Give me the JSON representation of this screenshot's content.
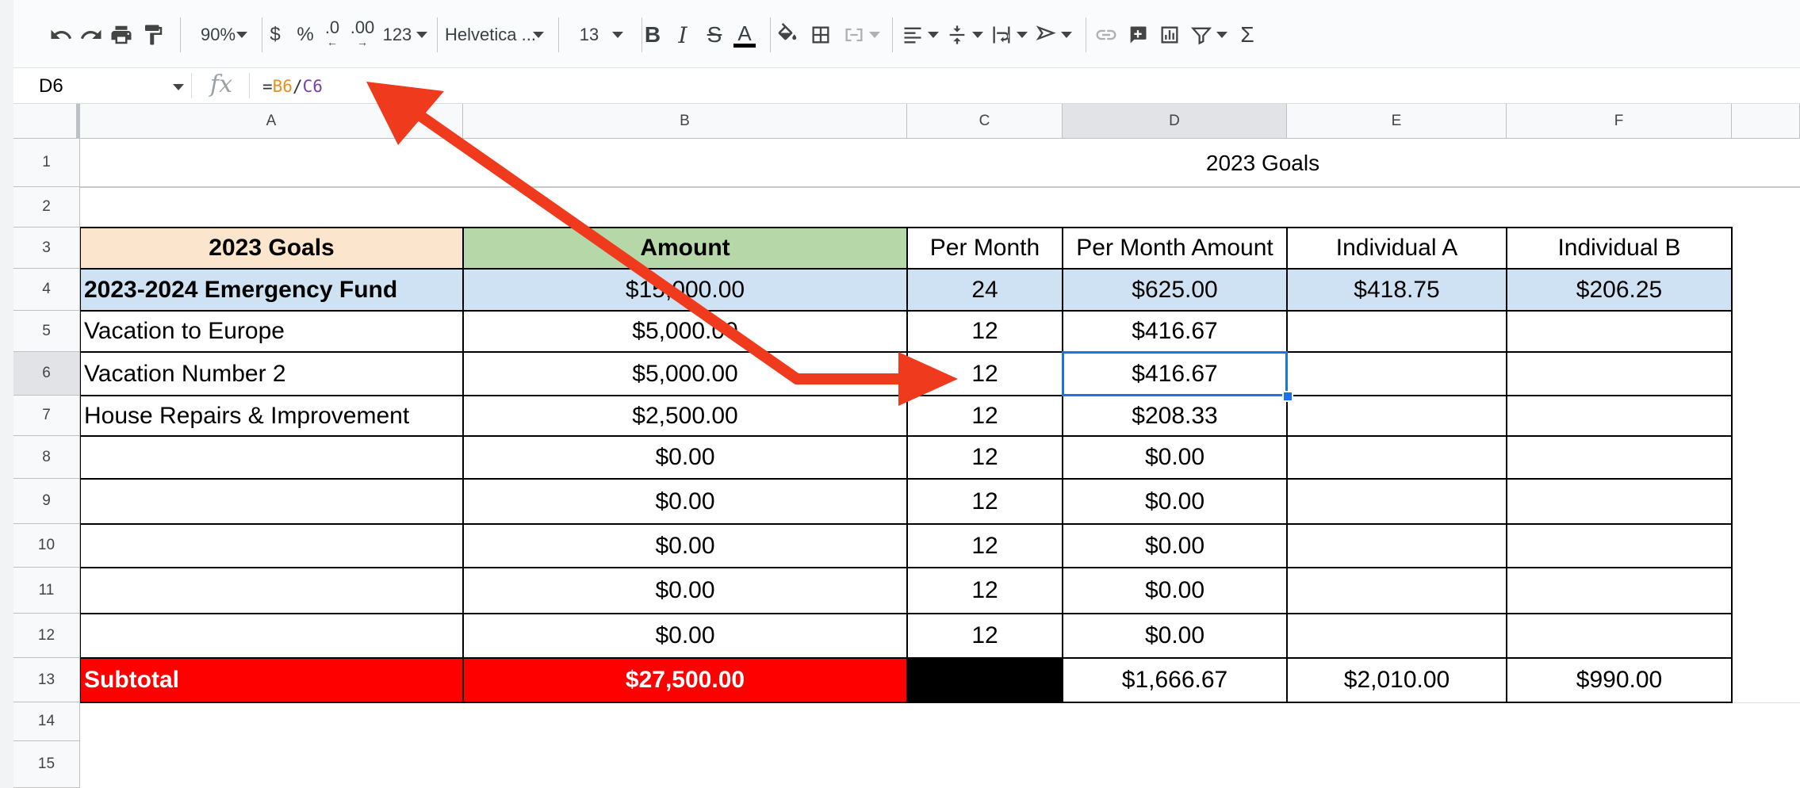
{
  "toolbar": {
    "zoom": "90%",
    "currency_symbol": "$",
    "percent_symbol": "%",
    "decrease_decimals_label": ".0",
    "increase_decimals_label": ".00",
    "number_format_label": "123",
    "font_family": "Helvetica ...",
    "font_size": "13",
    "text_color": "#000000"
  },
  "formula_bar": {
    "name_box": "D6",
    "fx": "fx",
    "formula_parts": [
      {
        "text": "=",
        "color": "#333333"
      },
      {
        "text": "B6",
        "color": "#e6911d"
      },
      {
        "text": "/",
        "color": "#333333"
      },
      {
        "text": "C6",
        "color": "#7b3ea6"
      }
    ]
  },
  "columns": [
    "A",
    "B",
    "C",
    "D",
    "E",
    "F"
  ],
  "rows": [
    "1",
    "2",
    "3",
    "4",
    "5",
    "6",
    "7",
    "8",
    "9",
    "10",
    "11",
    "12",
    "13",
    "14",
    "15"
  ],
  "selected_cell": "D6",
  "sheet": {
    "title": "2023 Goals",
    "header": {
      "goals": "2023 Goals",
      "amount": "Amount",
      "per_month": "Per Month",
      "per_month_amount": "Per Month Amount",
      "individual_a": "Individual A",
      "individual_b": "Individual B"
    },
    "goal_rows": [
      {
        "goal": "2023-2024 Emergency Fund",
        "amount": "$15,000.00",
        "per_month": "24",
        "per_month_amount": "$625.00",
        "individual_a": "$418.75",
        "individual_b": "$206.25"
      },
      {
        "goal": "Vacation to Europe",
        "amount": "$5,000.00",
        "per_month": "12",
        "per_month_amount": "$416.67",
        "individual_a": "",
        "individual_b": ""
      },
      {
        "goal": "Vacation Number 2",
        "amount": "$5,000.00",
        "per_month": "12",
        "per_month_amount": "$416.67",
        "individual_a": "",
        "individual_b": ""
      },
      {
        "goal": "House Repairs & Improvement",
        "amount": "$2,500.00",
        "per_month": "12",
        "per_month_amount": "$208.33",
        "individual_a": "",
        "individual_b": ""
      },
      {
        "goal": "",
        "amount": "$0.00",
        "per_month": "12",
        "per_month_amount": "$0.00",
        "individual_a": "",
        "individual_b": ""
      },
      {
        "goal": "",
        "amount": "$0.00",
        "per_month": "12",
        "per_month_amount": "$0.00",
        "individual_a": "",
        "individual_b": ""
      },
      {
        "goal": "",
        "amount": "$0.00",
        "per_month": "12",
        "per_month_amount": "$0.00",
        "individual_a": "",
        "individual_b": ""
      },
      {
        "goal": "",
        "amount": "$0.00",
        "per_month": "12",
        "per_month_amount": "$0.00",
        "individual_a": "",
        "individual_b": ""
      },
      {
        "goal": "",
        "amount": "$0.00",
        "per_month": "12",
        "per_month_amount": "$0.00",
        "individual_a": "",
        "individual_b": ""
      }
    ],
    "subtotal": {
      "label": "Subtotal",
      "amount": "$27,500.00",
      "per_month": "",
      "per_month_amount": "$1,666.67",
      "individual_a": "$2,010.00",
      "individual_b": "$990.00"
    }
  },
  "colors": {
    "goals_header_bg": "#fce5cd",
    "amount_header_bg": "#b6d7a8",
    "emergency_row_bg": "#cfe2f3",
    "subtotal_bg": "#ff0000",
    "subtotal_text": "#ffffff",
    "subtotal_per_month_bg": "#000000",
    "selection": "#1a73e8",
    "annotation_arrow": "#f03a1e"
  },
  "annotations": [
    {
      "name": "arrow-to-formula",
      "meaning": "points from cell C6 region to the formula bar"
    },
    {
      "name": "arrow-to-c6",
      "meaning": "points to the Per Month value used in the formula"
    }
  ]
}
